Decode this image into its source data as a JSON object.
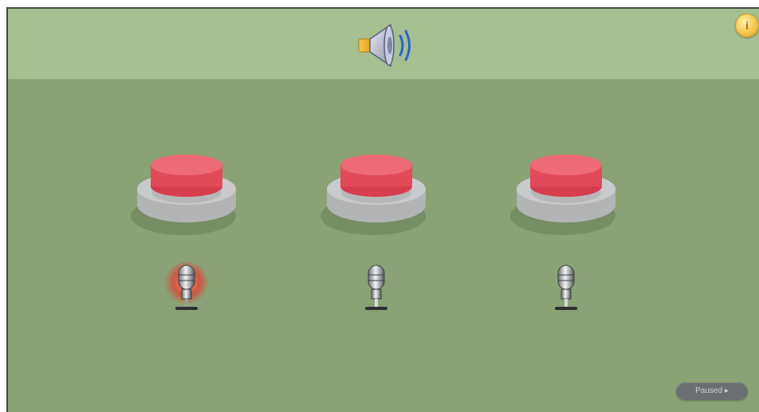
{
  "header": {
    "audio_icon": "speaker-icon",
    "info_icon": "info-icon",
    "info_label": "i"
  },
  "buzzers": [
    {
      "icon": "red-buzzer-button-icon",
      "mic_icon": "microphone-icon",
      "mic_active": true
    },
    {
      "icon": "red-buzzer-button-icon",
      "mic_icon": "microphone-icon",
      "mic_active": false
    },
    {
      "icon": "red-buzzer-button-icon",
      "mic_icon": "microphone-icon",
      "mic_active": false
    }
  ],
  "footer": {
    "status_label": "Paused ▸"
  },
  "colors": {
    "background": "#8aa275",
    "header": "#a6bf90",
    "buzzer_cap": "#e54a5a",
    "buzzer_base": "#b9babd",
    "mic_active_glow": "#d84a3a"
  }
}
